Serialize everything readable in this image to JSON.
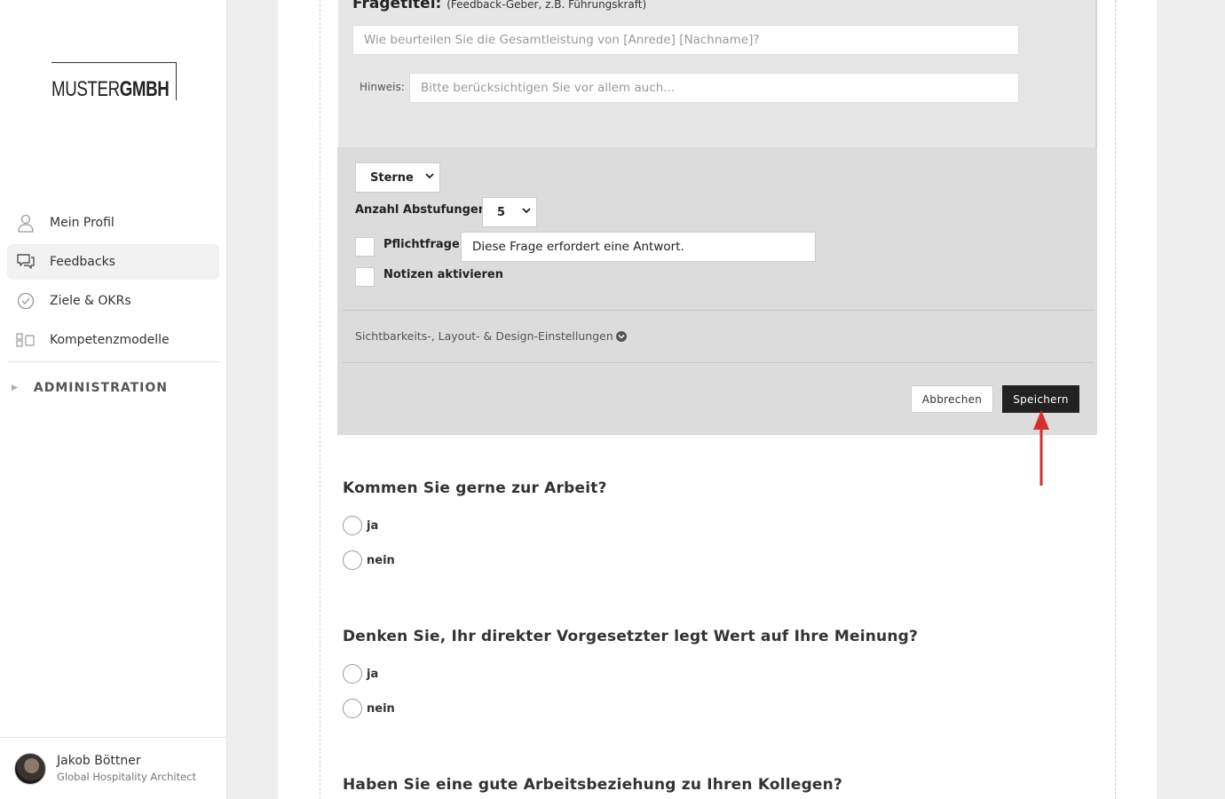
{
  "sidebar": {
    "logo": {
      "part1": "MUSTER",
      "part2": "GMBH"
    },
    "items": [
      {
        "label": "Mein Profil",
        "icon": "user-icon"
      },
      {
        "label": "Feedbacks",
        "icon": "chat-icon",
        "active": true
      },
      {
        "label": "Ziele & OKRs",
        "icon": "check-circle-icon"
      },
      {
        "label": "Kompetenzmodelle",
        "icon": "model-icon"
      }
    ],
    "admin_label": "ADMINISTRATION",
    "user": {
      "name": "Jakob Böttner",
      "role": "Global Hospitality Architect"
    }
  },
  "editor": {
    "title": "Fragetitel:",
    "title_note": "(Feedback-Geber, z.B. Führungskraft)",
    "question_placeholder": "Wie beurteilen Sie die Gesamtleistung von [Anrede] [Nachname]?",
    "hint_label": "Hinweis:",
    "hint_placeholder": "Bitte berücksichtigen Sie vor allem auch...",
    "type_select": "Sterne",
    "steps_label": "Anzahl Abstufungen",
    "steps_value": "5",
    "required_label": "Pflichtfrage",
    "required_text": "Diese Frage erfordert eine Antwort.",
    "notes_label": "Notizen aktivieren",
    "settings_link": "Sichtbarkeits-, Layout- & Design-Einstellungen",
    "cancel_label": "Abbrechen",
    "save_label": "Speichern",
    "accent_arrow_color": "#d62f2f"
  },
  "questions": [
    {
      "text": "Kommen Sie gerne zur Arbeit?",
      "options": [
        "ja",
        "nein"
      ]
    },
    {
      "text": "Denken Sie, Ihr direkter Vorgesetzter legt Wert auf Ihre Meinung?",
      "options": [
        "ja",
        "nein"
      ]
    },
    {
      "text": "Haben Sie eine gute Arbeitsbeziehung zu Ihren Kollegen?",
      "options": []
    }
  ]
}
